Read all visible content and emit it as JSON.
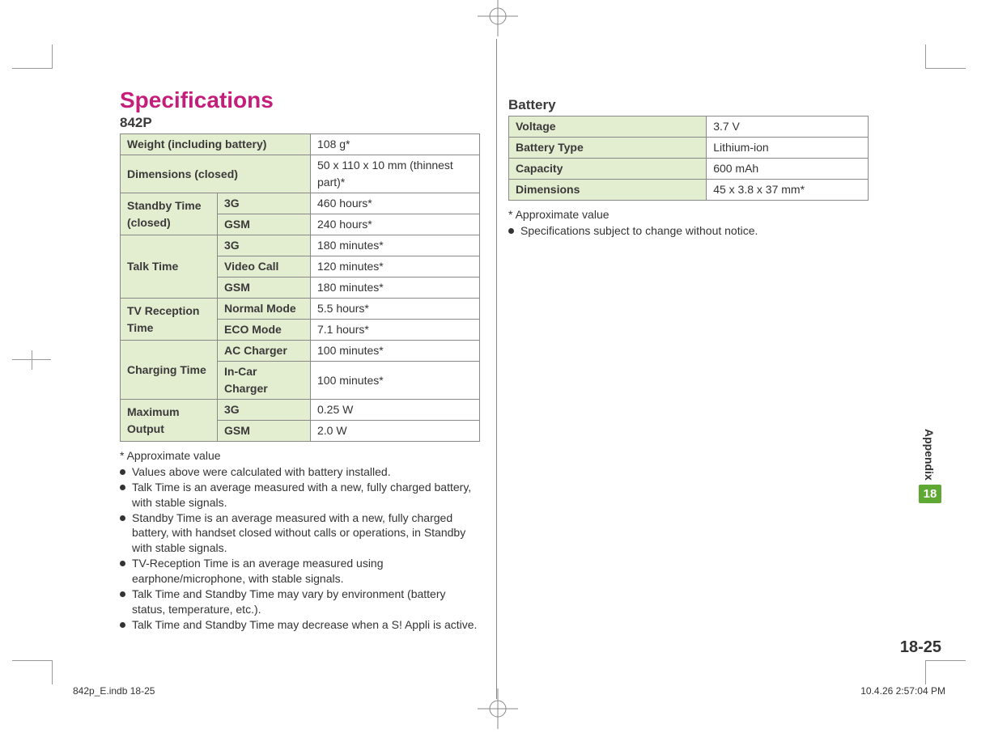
{
  "page": {
    "title": "Specifications",
    "model": "842P",
    "tab_label": "Appendix",
    "tab_number": "18",
    "page_number": "18-25",
    "footer_file": "842p_E.indb   18-25",
    "footer_date": "10.4.26   2:57:04 PM"
  },
  "table_842p": {
    "rows": [
      {
        "label": "Weight (including battery)",
        "sub": "",
        "value": "108 g*"
      },
      {
        "label": "Dimensions (closed)",
        "sub": "",
        "value": "50 x 110 x 10 mm (thinnest part)*"
      }
    ],
    "groups": [
      {
        "label": "Standby Time (closed)",
        "items": [
          {
            "sub": "3G",
            "value": "460 hours*"
          },
          {
            "sub": "GSM",
            "value": "240 hours*"
          }
        ]
      },
      {
        "label": "Talk Time",
        "items": [
          {
            "sub": "3G",
            "value": "180 minutes*"
          },
          {
            "sub": "Video Call",
            "value": "120 minutes*"
          },
          {
            "sub": "GSM",
            "value": "180 minutes*"
          }
        ]
      },
      {
        "label": "TV Reception Time",
        "items": [
          {
            "sub": "Normal Mode",
            "value": "5.5 hours*"
          },
          {
            "sub": "ECO Mode",
            "value": "7.1 hours*"
          }
        ]
      },
      {
        "label": "Charging Time",
        "items": [
          {
            "sub": "AC Charger",
            "value": "100 minutes*"
          },
          {
            "sub": "In-Car Charger",
            "value": "100 minutes*"
          }
        ]
      },
      {
        "label": "Maximum Output",
        "items": [
          {
            "sub": "3G",
            "value": "0.25 W"
          },
          {
            "sub": "GSM",
            "value": "2.0 W"
          }
        ]
      }
    ]
  },
  "notes_left": {
    "asterisk": "* Approximate value",
    "bullets": [
      "Values above were calculated with battery installed.",
      "Talk Time is an average measured with a new, fully charged battery, with stable signals.",
      "Standby Time is an average measured with a new, fully charged battery, with handset closed without calls or operations, in Standby with stable signals.",
      "TV-Reception Time is an average measured using earphone/microphone, with stable signals.",
      "Talk Time and Standby Time may vary by environment (battery status, temperature, etc.).",
      "Talk Time and Standby Time may decrease when a S! Appli is active."
    ]
  },
  "battery": {
    "heading": "Battery",
    "rows": [
      {
        "label": "Voltage",
        "value": "3.7 V"
      },
      {
        "label": "Battery Type",
        "value": "Lithium-ion"
      },
      {
        "label": "Capacity",
        "value": "600 mAh"
      },
      {
        "label": "Dimensions",
        "value": "45 x 3.8 x 37 mm*"
      }
    ]
  },
  "notes_right": {
    "asterisk": "* Approximate value",
    "bullets": [
      "Specifications subject to change without notice."
    ]
  }
}
